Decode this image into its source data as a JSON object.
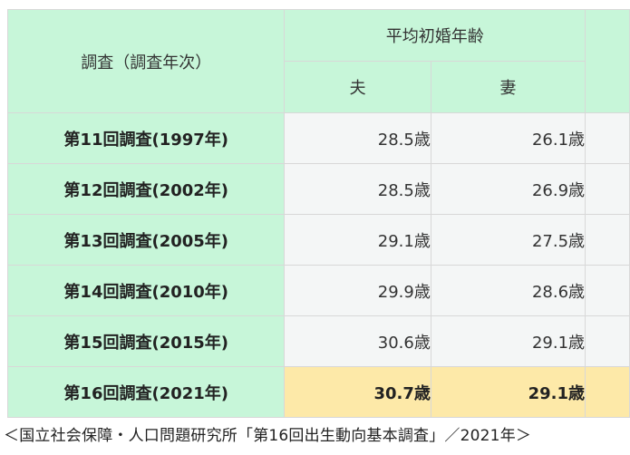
{
  "table": {
    "corner_header": "調査（調査年次）",
    "group_header": "平均初婚年齢",
    "col_husband": "夫",
    "col_wife": "妻",
    "rows": [
      {
        "survey": "第11回調査(1997年)",
        "husband": "28.5歳",
        "wife": "26.1歳"
      },
      {
        "survey": "第12回調査(2002年)",
        "husband": "28.5歳",
        "wife": "26.9歳"
      },
      {
        "survey": "第13回調査(2005年)",
        "husband": "29.1歳",
        "wife": "27.5歳"
      },
      {
        "survey": "第14回調査(2010年)",
        "husband": "29.9歳",
        "wife": "28.6歳"
      },
      {
        "survey": "第15回調査(2015年)",
        "husband": "30.6歳",
        "wife": "29.1歳"
      },
      {
        "survey": "第16回調査(2021年)",
        "husband": "30.7歳",
        "wife": "29.1歳"
      }
    ],
    "highlight_color": "#fde9a8",
    "header_color": "#c7f6d9"
  },
  "source": "＜国立社会保障・人口問題研究所「第16回出生動向基本調査」／2021年＞"
}
